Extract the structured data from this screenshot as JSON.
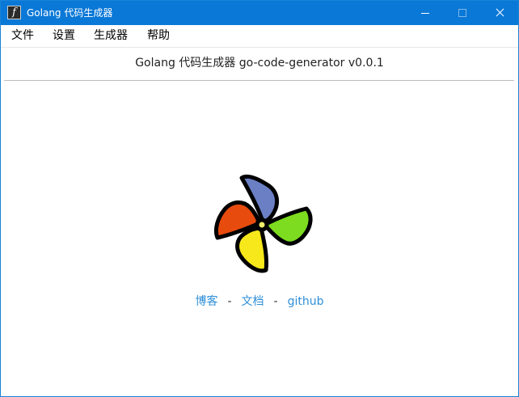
{
  "window": {
    "title": "Golang 代码生成器",
    "app_icon_glyph": "f"
  },
  "menu": {
    "items": [
      "文件",
      "设置",
      "生成器",
      "帮助"
    ]
  },
  "header": {
    "title": "Golang 代码生成器 go-code-generator v0.0.1"
  },
  "logo": {
    "icon": "pinwheel-logo-icon",
    "colors": {
      "blue": "#6b7fc4",
      "green": "#7ddc1f",
      "yellow": "#f7e81b",
      "red": "#e84b0e",
      "center": "#f0ee6a",
      "outline": "#000000"
    }
  },
  "links": {
    "blog": "博客",
    "separator": "-",
    "docs": "文档",
    "github": "github"
  },
  "colors": {
    "titlebar": "#0a78d7",
    "link": "#2f8fd8"
  }
}
